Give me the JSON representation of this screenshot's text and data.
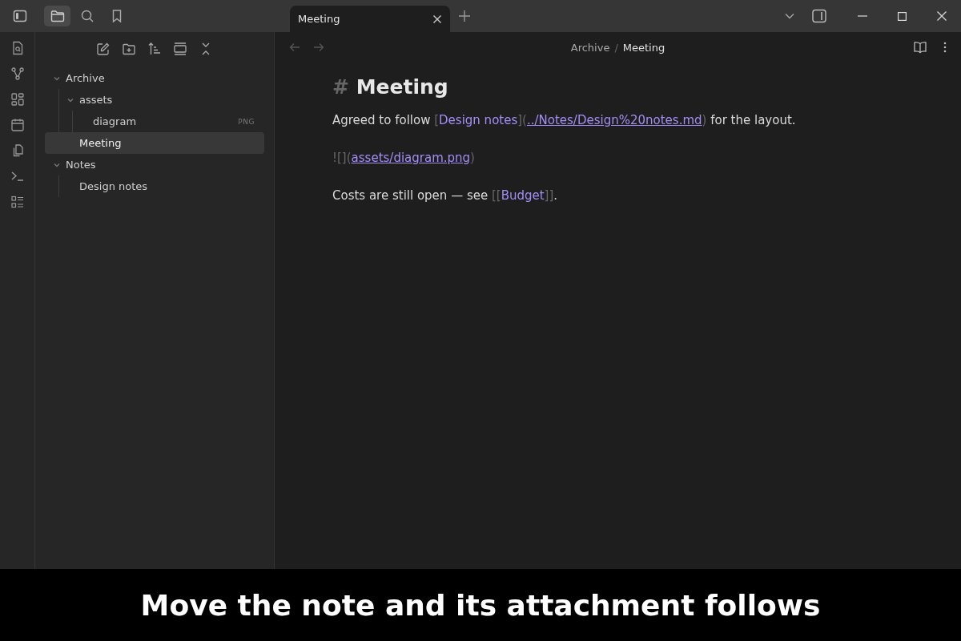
{
  "tab": {
    "title": "Meeting",
    "selected": true
  },
  "breadcrumb": [
    "Archive",
    "Meeting"
  ],
  "breadcrumb_separator": "/",
  "tree": [
    {
      "name": "Archive",
      "kind": "folder",
      "expanded": true,
      "selected": false,
      "children": [
        {
          "name": "assets",
          "kind": "folder",
          "expanded": true,
          "selected": false,
          "children": [
            {
              "name": "diagram",
              "kind": "file",
              "badge": "PNG",
              "selected": false
            }
          ]
        },
        {
          "name": "Meeting",
          "kind": "file",
          "selected": true
        }
      ]
    },
    {
      "name": "Notes",
      "kind": "folder",
      "expanded": true,
      "selected": false,
      "children": [
        {
          "name": "Design notes",
          "kind": "file",
          "selected": false
        }
      ]
    }
  ],
  "note": {
    "heading_mark": "#",
    "heading": "Meeting",
    "paragraphs": [
      [
        {
          "kind": "text",
          "text": "Agreed to follow "
        },
        {
          "kind": "syntax",
          "text": "["
        },
        {
          "kind": "link",
          "text": "Design notes"
        },
        {
          "kind": "syntax",
          "text": "]("
        },
        {
          "kind": "url",
          "text": "../Notes/Design%20notes.md"
        },
        {
          "kind": "syntax",
          "text": ")"
        },
        {
          "kind": "text",
          "text": " for the layout."
        }
      ],
      [
        {
          "kind": "syntax",
          "text": "![]("
        },
        {
          "kind": "url",
          "text": "assets/diagram.png"
        },
        {
          "kind": "syntax",
          "text": ")"
        }
      ],
      [
        {
          "kind": "text",
          "text": "Costs are still open — see "
        },
        {
          "kind": "syntax",
          "text": "[["
        },
        {
          "kind": "link",
          "text": "Budget"
        },
        {
          "kind": "syntax",
          "text": "]]"
        },
        {
          "kind": "text",
          "text": "."
        }
      ]
    ]
  },
  "caption": "Move the note and its attachment follows"
}
